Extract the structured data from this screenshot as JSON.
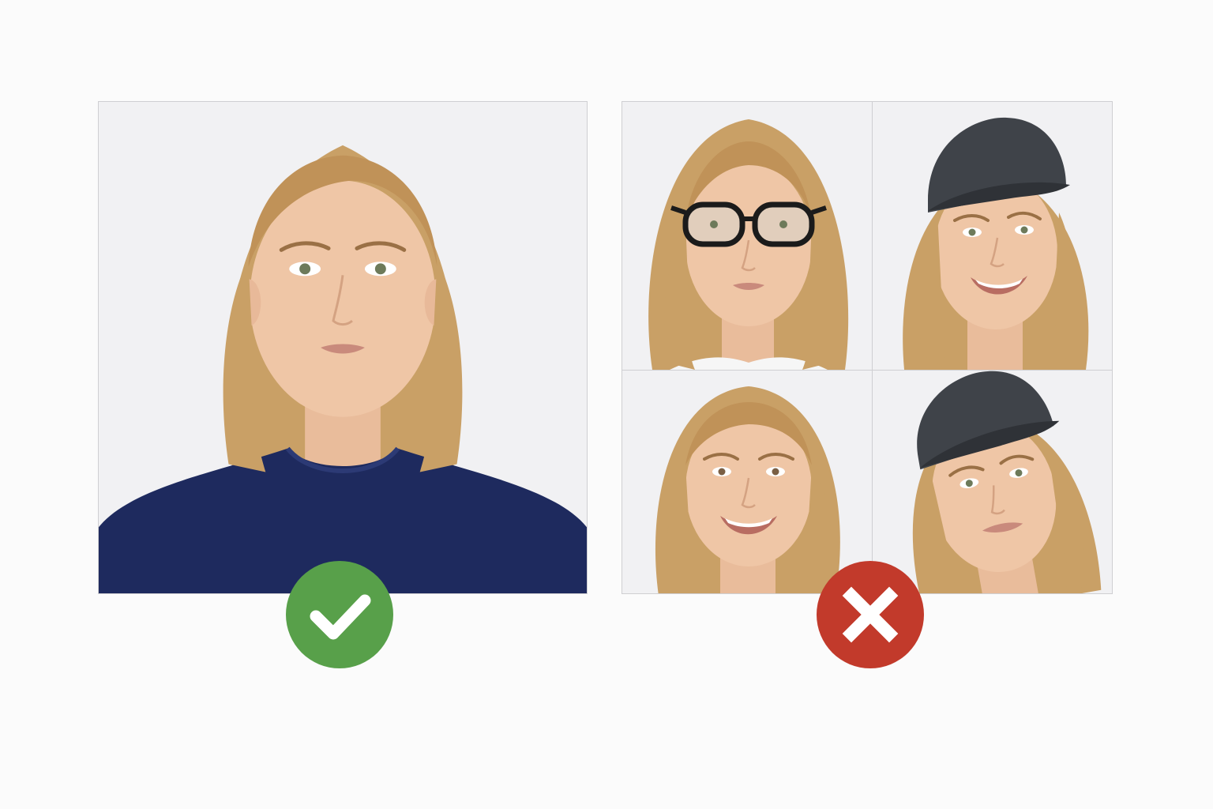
{
  "colors": {
    "background": "#fbfbfb",
    "panel_background": "#f1f1f3",
    "panel_border": "#cfcfd2",
    "hair": "#c9a066",
    "skin": "#efc6a6",
    "shirt": "#1e2a5e",
    "cap": "#3f4349",
    "glasses_frame": "#1b1b1b",
    "approved_badge": "#58a04a",
    "rejected_badge": "#c23a2b",
    "badge_mark": "#ffffff"
  },
  "icons": {
    "approved": "check-mark-icon",
    "rejected": "cross-mark-icon"
  },
  "examples": {
    "approved": {
      "description_icon": "neutral-frontal-portrait"
    },
    "rejected": [
      {
        "variant": "glasses"
      },
      {
        "variant": "cap-smiling"
      },
      {
        "variant": "smiling"
      },
      {
        "variant": "cap-tilted"
      }
    ]
  }
}
